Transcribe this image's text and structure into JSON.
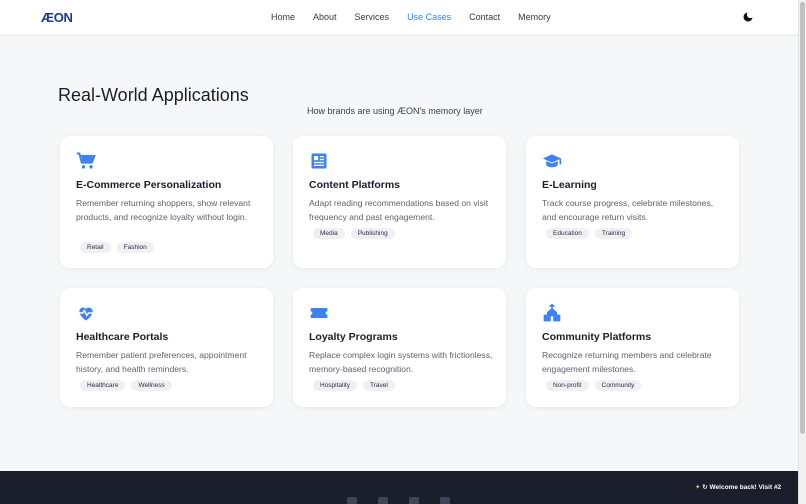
{
  "brand": {
    "logo": "ÆON"
  },
  "nav": {
    "items": [
      {
        "label": "Home"
      },
      {
        "label": "About"
      },
      {
        "label": "Services"
      },
      {
        "label": "Use Cases"
      },
      {
        "label": "Contact"
      },
      {
        "label": "Memory"
      }
    ]
  },
  "hero": {
    "title": "Real-World Applications",
    "subtitle": "How brands are using ÆON's memory layer"
  },
  "cards": [
    {
      "icon": "shopping-cart-icon",
      "title": "E-Commerce Personalization",
      "desc": "Remember returning shoppers, show relevant products, and recognize loyalty without login.",
      "tags": [
        "Retail",
        "Fashion"
      ]
    },
    {
      "icon": "newspaper-icon",
      "title": "Content Platforms",
      "desc": "Adapt reading recommendations based on visit frequency and past engagement.",
      "tags": [
        "Media",
        "Publishing"
      ]
    },
    {
      "icon": "graduation-cap-icon",
      "title": "E-Learning",
      "desc": "Track course progress, celebrate milestones, and encourage return visits.",
      "tags": [
        "Education",
        "Training"
      ]
    },
    {
      "icon": "heart-pulse-icon",
      "title": "Healthcare Portals",
      "desc": "Remember patient preferences, appointment history, and health reminders.",
      "tags": [
        "Healthcare",
        "Wellness"
      ]
    },
    {
      "icon": "ticket-icon",
      "title": "Loyalty Programs",
      "desc": "Replace complex login systems with frictionless, memory-based recognition.",
      "tags": [
        "Hospitality",
        "Travel"
      ]
    },
    {
      "icon": "church-icon",
      "title": "Community Platforms",
      "desc": "Recognize returning members and celebrate engagement milestones.",
      "tags": [
        "Non-profit",
        "Community"
      ]
    }
  ],
  "toast": {
    "text": "↻ Welcome back! Visit #2"
  },
  "colors": {
    "accent": "#3b82f6",
    "footer": "#1b1f2b"
  }
}
